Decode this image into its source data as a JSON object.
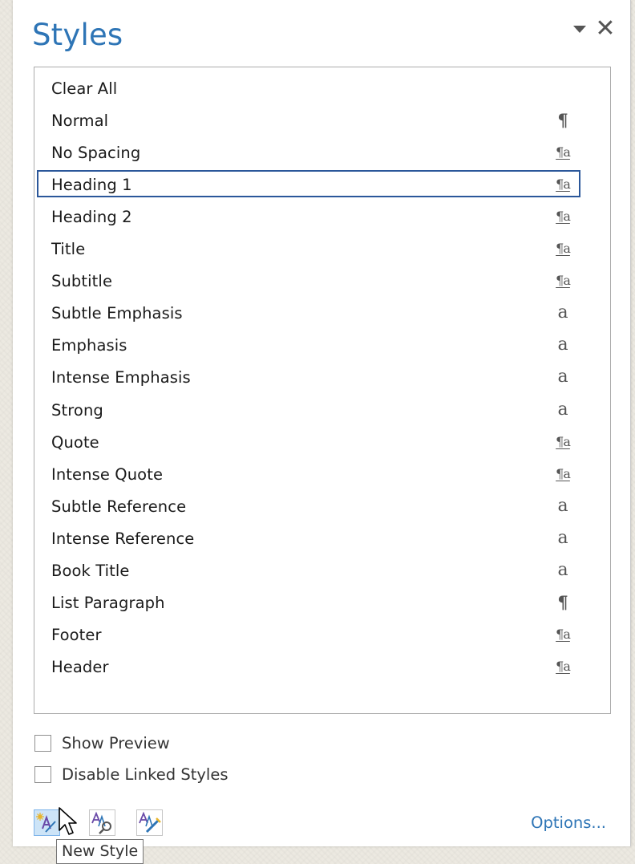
{
  "pane": {
    "title": "Styles",
    "menu_icon": "dropdown-triangle-icon",
    "close_label": "✕"
  },
  "styles": [
    {
      "name": "Clear All",
      "glyph": "",
      "kind": "none"
    },
    {
      "name": "Normal",
      "glyph": "¶",
      "kind": "para"
    },
    {
      "name": "No Spacing",
      "glyph": "¶a",
      "kind": "linked"
    },
    {
      "name": "Heading 1",
      "glyph": "¶a",
      "kind": "linked",
      "selected": true
    },
    {
      "name": "Heading 2",
      "glyph": "¶a",
      "kind": "linked"
    },
    {
      "name": "Title",
      "glyph": "¶a",
      "kind": "linked"
    },
    {
      "name": "Subtitle",
      "glyph": "¶a",
      "kind": "linked"
    },
    {
      "name": "Subtle Emphasis",
      "glyph": "a",
      "kind": "char"
    },
    {
      "name": "Emphasis",
      "glyph": "a",
      "kind": "char"
    },
    {
      "name": "Intense Emphasis",
      "glyph": "a",
      "kind": "char"
    },
    {
      "name": "Strong",
      "glyph": "a",
      "kind": "char"
    },
    {
      "name": "Quote",
      "glyph": "¶a",
      "kind": "linked"
    },
    {
      "name": "Intense Quote",
      "glyph": "¶a",
      "kind": "linked"
    },
    {
      "name": "Subtle Reference",
      "glyph": "a",
      "kind": "char"
    },
    {
      "name": "Intense Reference",
      "glyph": "a",
      "kind": "char"
    },
    {
      "name": "Book Title",
      "glyph": "a",
      "kind": "char"
    },
    {
      "name": "List Paragraph",
      "glyph": "¶",
      "kind": "para"
    },
    {
      "name": "Footer",
      "glyph": "¶a",
      "kind": "linked"
    },
    {
      "name": "Header",
      "glyph": "¶a",
      "kind": "linked"
    }
  ],
  "options": {
    "show_preview": {
      "label": "Show Preview",
      "checked": false
    },
    "disable_linked": {
      "label": "Disable Linked Styles",
      "checked": false
    }
  },
  "toolbar": {
    "new_style_icon": "new-style-icon",
    "style_inspector_icon": "style-inspector-icon",
    "manage_styles_icon": "manage-styles-icon",
    "options_label": "Options..."
  },
  "tooltip": {
    "text": "New Style"
  },
  "colors": {
    "accent": "#2e75b6",
    "selection_border": "#2b579a",
    "hover_fill": "#cde4f7"
  }
}
